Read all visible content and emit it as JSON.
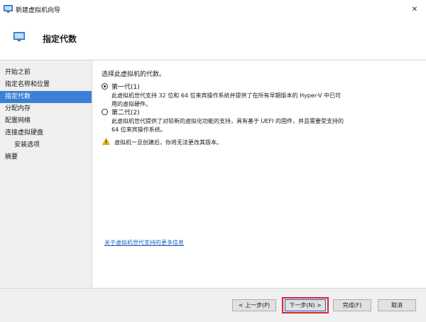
{
  "window": {
    "title": "新建虚拟机向导",
    "close_glyph": "✕"
  },
  "header": {
    "title": "指定代数"
  },
  "sidebar": {
    "items": [
      {
        "label": "开始之前",
        "active": false,
        "sub": false
      },
      {
        "label": "指定名称和位置",
        "active": false,
        "sub": false
      },
      {
        "label": "指定代数",
        "active": true,
        "sub": false
      },
      {
        "label": "分配内存",
        "active": false,
        "sub": false
      },
      {
        "label": "配置网络",
        "active": false,
        "sub": false
      },
      {
        "label": "连接虚拟硬盘",
        "active": false,
        "sub": false
      },
      {
        "label": "安装选项",
        "active": false,
        "sub": true
      },
      {
        "label": "摘要",
        "active": false,
        "sub": false
      }
    ]
  },
  "main": {
    "prompt": "选择此虚拟机的代数。",
    "gen1": {
      "label": "第一代(1)",
      "selected": true,
      "description": "此虚拟机世代支持 32 位和 64 位来宾操作系统并提供了在所有早期版本的 Hyper-V 中已可用的虚拟硬件。"
    },
    "gen2": {
      "label": "第二代(2)",
      "selected": false,
      "description": "此虚拟机世代提供了对较新的虚拟化功能的支持，具有基于 UEFI 的固件，并且需要受支持的 64 位来宾操作系统。"
    },
    "warning": "虚拟机一旦创建后，你将无法更改其版本。",
    "more_link": "关于虚拟机世代支持的更多信息"
  },
  "footer": {
    "prev_label": "< 上一步(P)",
    "next_label": "下一步(N) >",
    "finish_label": "完成(F)",
    "cancel_label": "取消"
  },
  "colors": {
    "accent": "#3c7fd6",
    "link": "#1a5fc9",
    "highlight": "#e0202e",
    "warning": "#f2b800"
  },
  "icons": {
    "window": "monitor-icon",
    "warning": "warning-triangle-icon",
    "close": "close-icon"
  }
}
